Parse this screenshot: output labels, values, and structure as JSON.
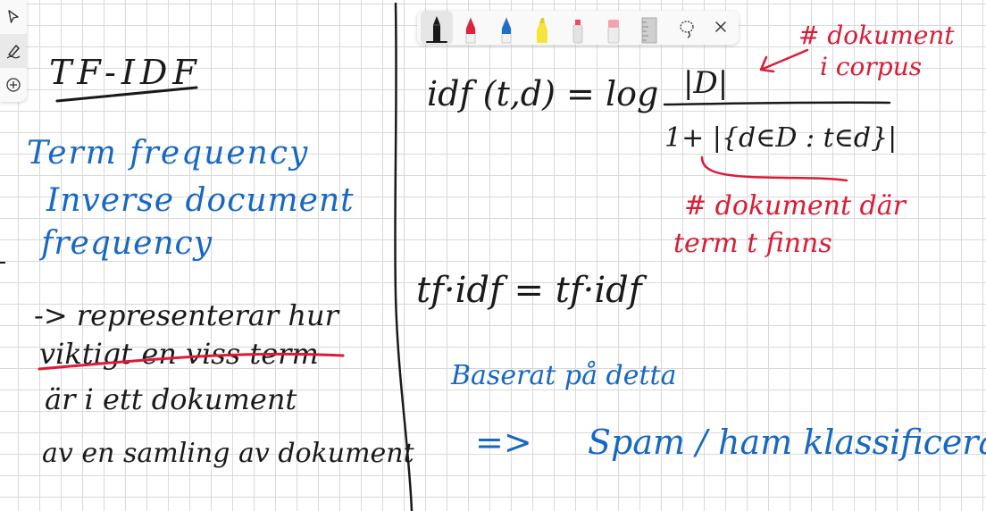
{
  "side_tools": [
    {
      "name": "select",
      "icon": "pointer-icon"
    },
    {
      "name": "ink",
      "icon": "pen-ink-icon"
    },
    {
      "name": "add",
      "icon": "add-circle-icon"
    }
  ],
  "pen_tray": [
    {
      "name": "black-pen",
      "color": "#1a1a1a",
      "active": true
    },
    {
      "name": "red-pen",
      "color": "#d9263a"
    },
    {
      "name": "blue-pen",
      "color": "#1f6fc5"
    },
    {
      "name": "yellow-highlighter",
      "color": "#f5e43a"
    },
    {
      "name": "gray-pen",
      "color": "#c8c8c8"
    },
    {
      "name": "eraser",
      "color": "#f2a2b0"
    },
    {
      "name": "ruler",
      "color": "#9a9a9a"
    },
    {
      "name": "lasso",
      "icon": "lasso-icon"
    },
    {
      "name": "close",
      "icon": "close-icon"
    }
  ],
  "colors": {
    "ink_black": "#1a1a1a",
    "ink_blue": "#1767c4",
    "ink_red": "#dc1b34",
    "grid": "#d9d9d9"
  },
  "notes": {
    "title": "TF-IDF",
    "term_frequency": "Term frequency",
    "inverse_document": "Inverse document",
    "frequency": "frequency",
    "line1": "-> representerar hur",
    "line2": "viktigt en viss term",
    "line3": "är i ett dokument",
    "line4": "av en samling av dokument",
    "idf_lhs": "idf (t,d) = log",
    "idf_num": "|D|",
    "idf_den": "1+ |{d∈D : t∈d}|",
    "note_corpus_1": "# dokument",
    "note_corpus_2": "i corpus",
    "note_term_1": "# dokument där",
    "note_term_2": "term t finns",
    "tfidf": "tf·idf = tf·idf",
    "baserat": "Baserat på detta",
    "arrow": "=>",
    "spam": "Spam / ham klassificera"
  }
}
